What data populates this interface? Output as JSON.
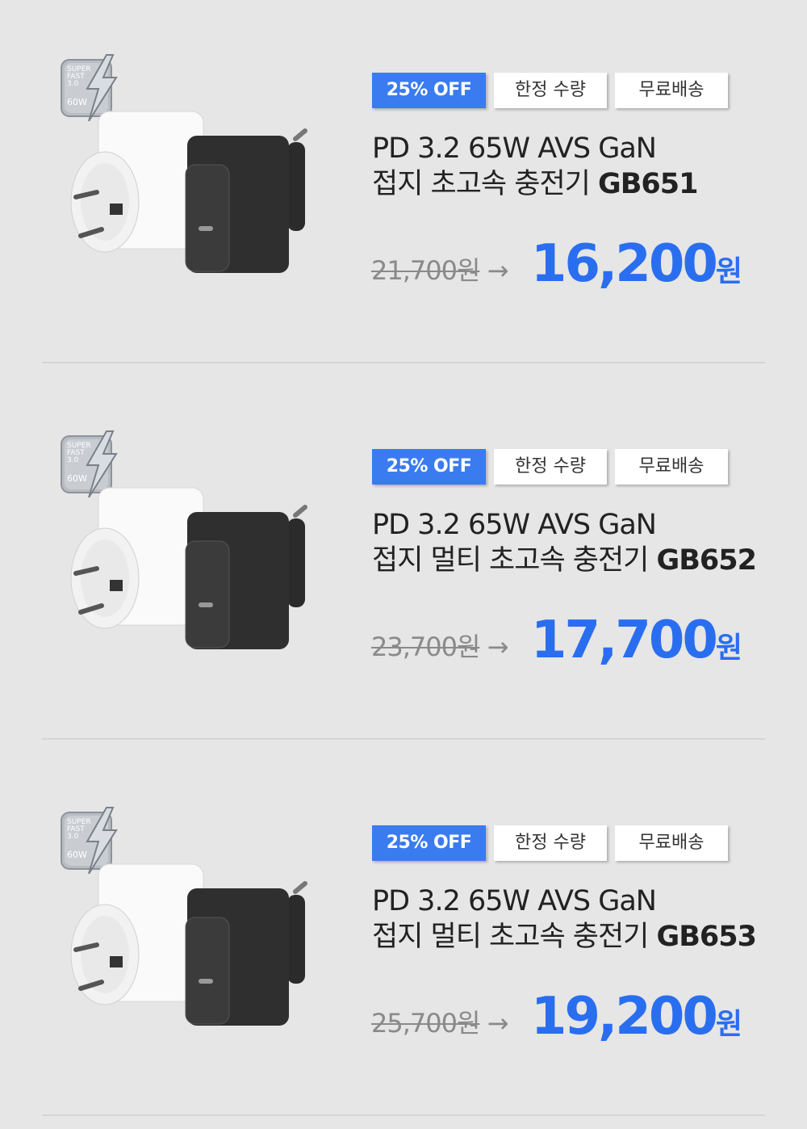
{
  "products": [
    {
      "tags": [
        "25% OFF",
        "한정 수량",
        "무료배송"
      ],
      "title_line1": "PD 3.2 65W AVS GaN",
      "title_line2_prefix": "접지 초고속 충전기 ",
      "model": "GB651",
      "old_price": "21,700원",
      "arrow": "→",
      "new_price": "16,200",
      "currency": "원"
    },
    {
      "tags": [
        "25% OFF",
        "한정 수량",
        "무료배송"
      ],
      "title_line1": "PD 3.2 65W AVS GaN",
      "title_line2_prefix": "접지 멀티 초고속 충전기 ",
      "model": "GB652",
      "old_price": "23,700원",
      "arrow": "→",
      "new_price": "17,700",
      "currency": "원"
    },
    {
      "tags": [
        "25% OFF",
        "한정 수량",
        "무료배송"
      ],
      "title_line1": "PD 3.2 65W AVS GaN",
      "title_line2_prefix": "접지 멀티 초고속 충전기 ",
      "model": "GB653",
      "old_price": "25,700원",
      "arrow": "→",
      "new_price": "19,200",
      "currency": "원"
    }
  ],
  "badge": {
    "lines": [
      "SUPER",
      "FAST",
      "3.0",
      "60W"
    ],
    "icon": "lightning-badge-icon"
  },
  "colors": {
    "accent": "#3a7bf0",
    "price": "#2a6ef0",
    "background": "#e6e6e6"
  }
}
